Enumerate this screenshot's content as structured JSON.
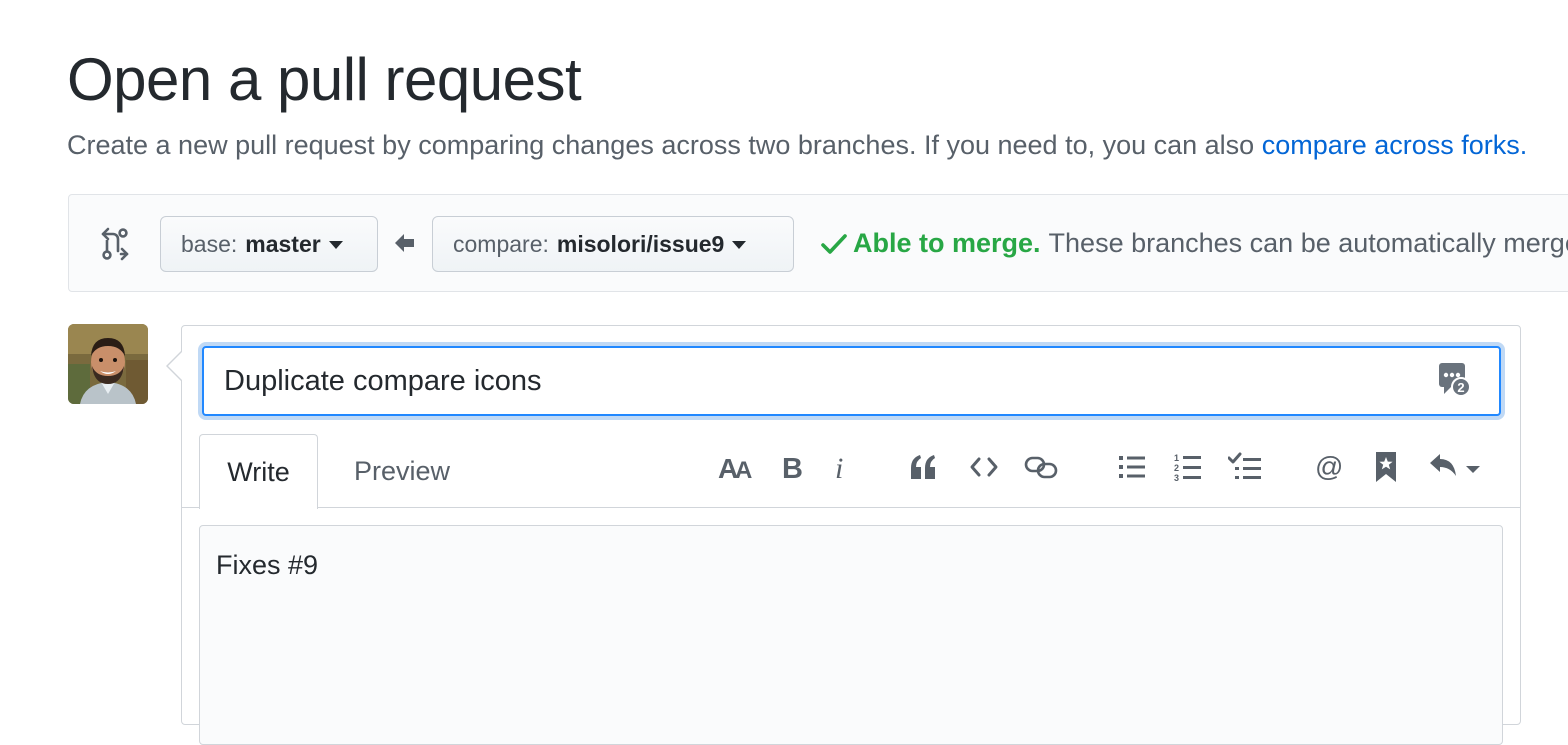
{
  "header": {
    "title": "Open a pull request",
    "subtitle_text": "Create a new pull request by comparing changes across two branches. If you need to, you can also ",
    "subtitle_link": "compare across forks."
  },
  "range": {
    "base_label": "base:",
    "base_branch": "master",
    "compare_label": "compare:",
    "compare_branch": "misolori/issue9",
    "merge_status": "Able to merge.",
    "merge_message": "These branches can be automatically merged."
  },
  "form": {
    "title_value": "Duplicate compare icons",
    "tabs": [
      {
        "label": "Write"
      },
      {
        "label": "Preview"
      }
    ],
    "body_value": "Fixes #9",
    "toolbar_icons": [
      "text-size-icon",
      "bold-icon",
      "italic-icon",
      "quote-icon",
      "code-icon",
      "link-icon",
      "unordered-list-icon",
      "ordered-list-icon",
      "task-list-icon",
      "mention-icon",
      "cross-reference-icon",
      "saved-replies-icon"
    ]
  },
  "colors": {
    "link": "#0366d6",
    "success": "#28a745",
    "focus": "#2188ff",
    "muted": "#586069"
  }
}
